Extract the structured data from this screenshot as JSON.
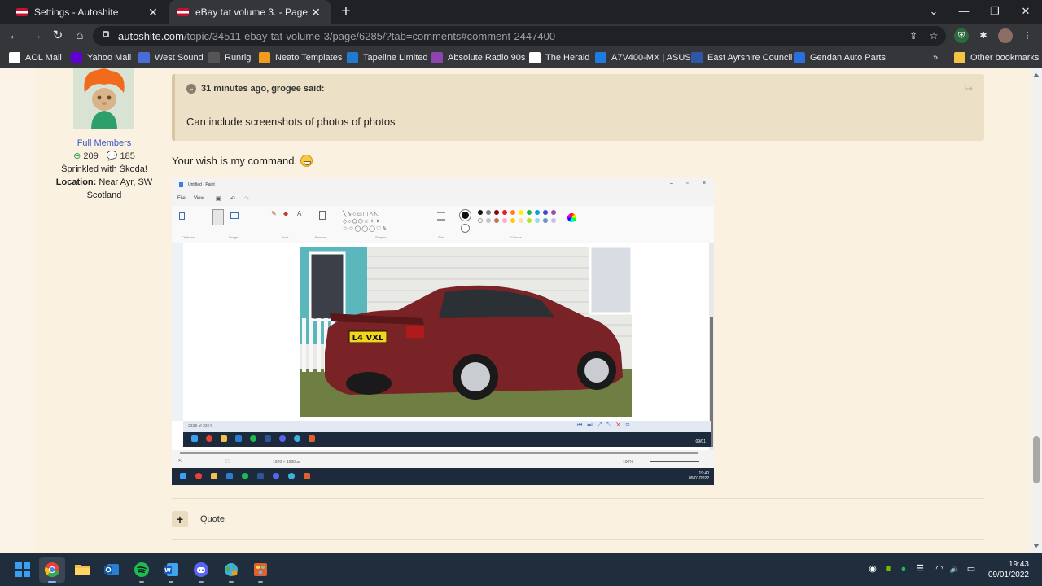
{
  "browser": {
    "tabs": [
      {
        "title": "Settings - Autoshite",
        "active": false
      },
      {
        "title": "eBay tat volume 3. - Page 6285 -",
        "active": true
      }
    ],
    "url": {
      "host": "autoshite.com",
      "path": "/topic/34511-ebay-tat-volume-3/page/6285/?tab=comments#comment-2447400"
    },
    "bookmarks": [
      {
        "label": "AOL Mail",
        "icon": "aol-icon"
      },
      {
        "label": "Yahoo Mail",
        "icon": "yahoo-icon"
      },
      {
        "label": "West Sound",
        "icon": "west-sound-icon"
      },
      {
        "label": "Runrig",
        "icon": "runrig-icon"
      },
      {
        "label": "Neato Templates",
        "icon": "neato-icon"
      },
      {
        "label": "Tapeline Limited",
        "icon": "tapeline-icon"
      },
      {
        "label": "Absolute Radio 90s",
        "icon": "absolute-radio-icon"
      },
      {
        "label": "The Herald",
        "icon": "herald-icon"
      },
      {
        "label": "A7V400-MX | ASUS",
        "icon": "asus-icon"
      },
      {
        "label": "East Ayrshire Council",
        "icon": "council-icon"
      },
      {
        "label": "Gendan Auto Parts",
        "icon": "gendan-icon"
      }
    ],
    "more_bookmarks": "»",
    "other_bookmarks": "Other bookmarks"
  },
  "author": {
    "group": "Full Members",
    "reputation": "209",
    "posts": "185",
    "tagline": "Šprinkled with Škoda!",
    "location_label": "Location:",
    "location": "Near Ayr, SW Scotland"
  },
  "quote": {
    "citation": "31 minutes ago, grogee said:",
    "text": "Can include screenshots of photos of photos"
  },
  "reply": {
    "text": "Your wish is my command."
  },
  "screenshot": {
    "paint": {
      "title": "Untitled - Paint",
      "menu": [
        "File",
        "View"
      ],
      "groups": [
        "Clipboard",
        "Image",
        "Tools",
        "Brushes",
        "Shapes",
        "Size",
        "Colours"
      ],
      "plate": "L4 VXL",
      "inner_status": "2338 of 2364",
      "status_dims": "1920 × 1080px",
      "zoom": "100%",
      "inner_clock": {
        "time": "",
        "date": "09/01"
      },
      "outer_clock": {
        "time": "19:40",
        "date": "09/01/2022"
      }
    }
  },
  "actions": {
    "quote_label": "Quote"
  },
  "taskbar": {
    "apps": [
      {
        "name": "windows-start-icon",
        "color": "#3aa0f3"
      },
      {
        "name": "chrome-icon",
        "color": "#e94235"
      },
      {
        "name": "file-explorer-icon",
        "color": "#f2c14e"
      },
      {
        "name": "outlook-icon",
        "color": "#2b7cd3"
      },
      {
        "name": "spotify-icon",
        "color": "#1db954"
      },
      {
        "name": "word-icon",
        "color": "#2b579a"
      },
      {
        "name": "discord-icon",
        "color": "#5865f2"
      },
      {
        "name": "globe-app-icon",
        "color": "#3fb0e0"
      },
      {
        "name": "paint-app-icon",
        "color": "#e06030"
      }
    ],
    "time": "19:43",
    "date": "09/01/2022"
  }
}
